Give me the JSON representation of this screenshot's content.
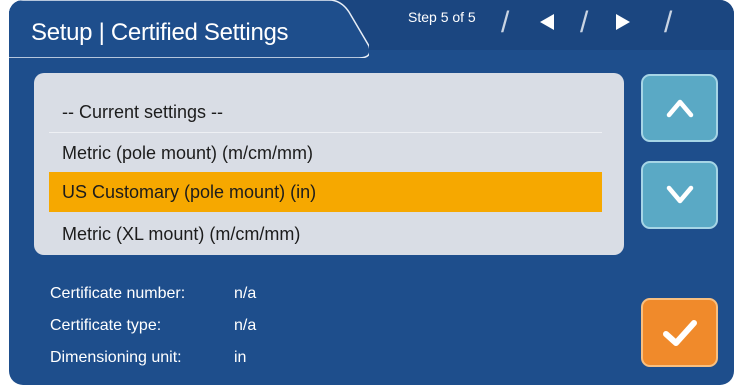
{
  "header": {
    "title": "Setup | Certified Settings",
    "step": "Step 5 of 5"
  },
  "icons": {
    "prev": "left-triangle-icon",
    "next": "right-triangle-icon",
    "scroll_up": "chevron-up-icon",
    "scroll_down": "chevron-down-icon",
    "confirm": "checkmark-icon"
  },
  "settings_list": {
    "items": [
      {
        "label": "-- Current settings --",
        "selected": false
      },
      {
        "label": "Metric (pole mount) (m/cm/mm)",
        "selected": false
      },
      {
        "label": "US Customary (pole mount) (in)",
        "selected": true
      },
      {
        "label": "Metric (XL mount) (m/cm/mm)",
        "selected": false
      }
    ]
  },
  "details": [
    {
      "label": "Certificate number:",
      "value": "n/a"
    },
    {
      "label": "Certificate type:",
      "value": "n/a"
    },
    {
      "label": "Dimensioning unit:",
      "value": "in"
    }
  ],
  "colors": {
    "panel": "#1e4e8c",
    "selection": "#f6a800",
    "scroll_button": "#5aa9c5",
    "confirm_button": "#f08a2b"
  }
}
